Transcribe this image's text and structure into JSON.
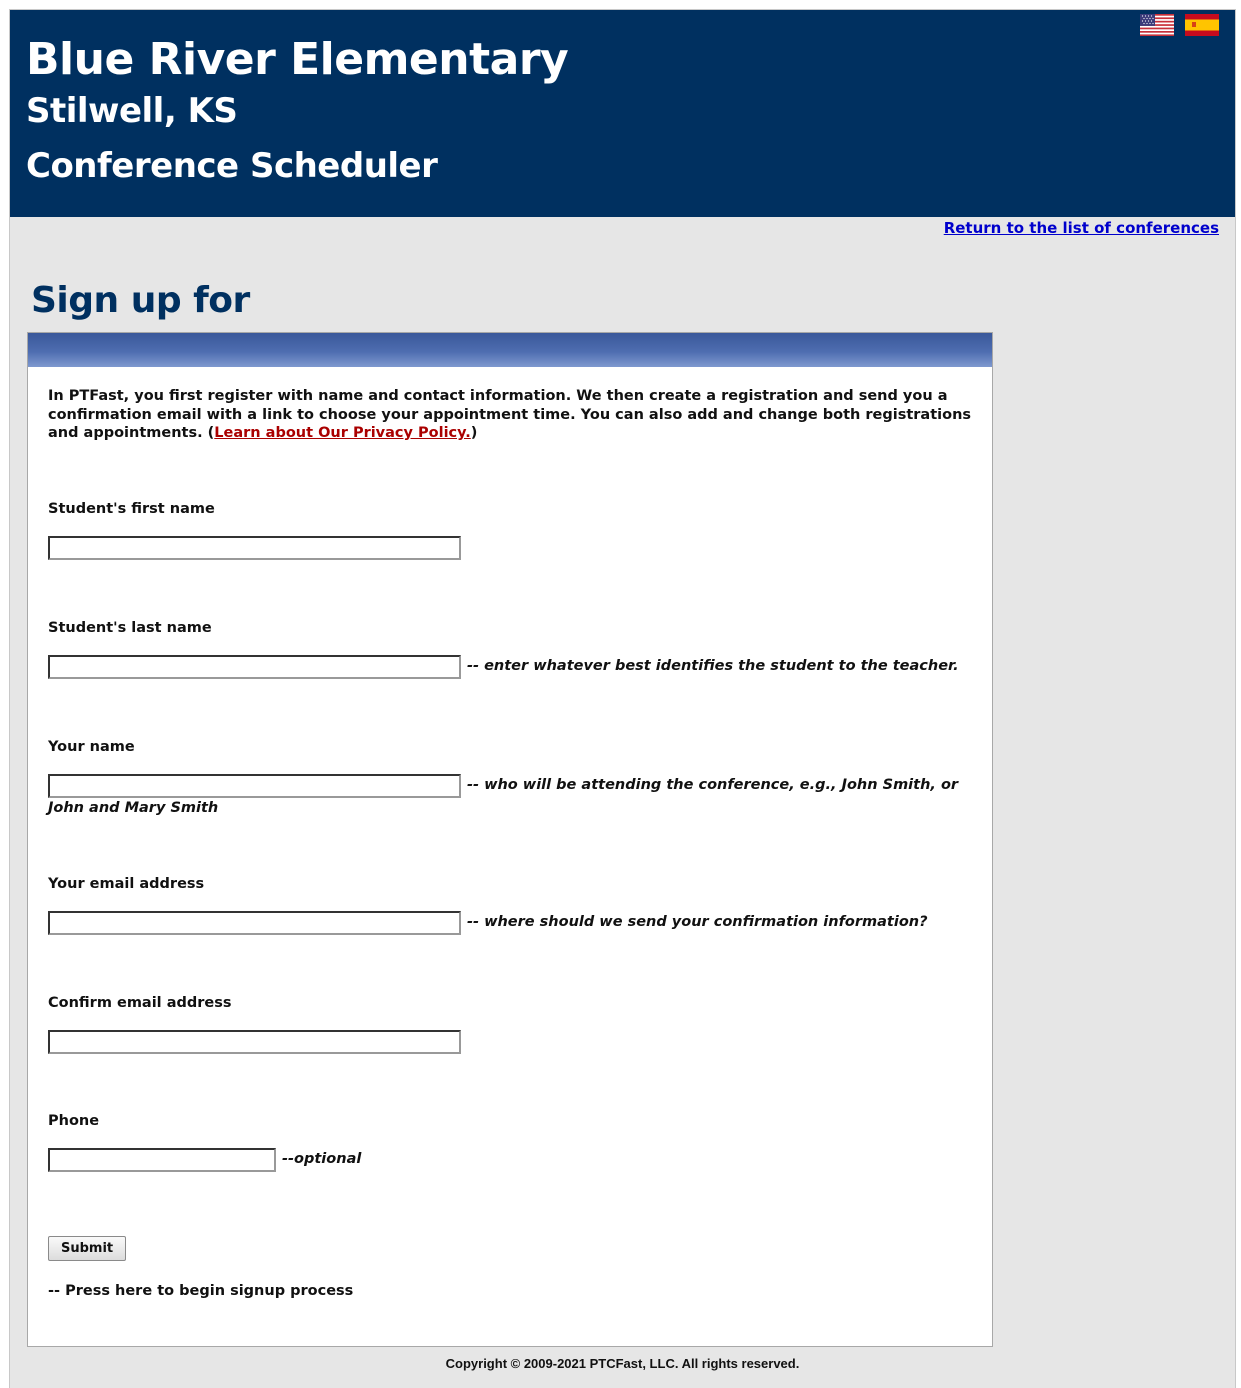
{
  "header": {
    "school_name": "Blue River Elementary",
    "city": "Stilwell, KS",
    "app_name": "Conference Scheduler",
    "languages": [
      {
        "name": "us-flag-icon",
        "label": "English"
      },
      {
        "name": "spain-flag-icon",
        "label": "Spanish"
      }
    ],
    "bg_color": "#003060"
  },
  "nav": {
    "return_link": "Return to the list of conferences"
  },
  "page": {
    "title": "Sign up for"
  },
  "intro": {
    "text_before": "In PTFast, you first register with name and contact information. We then create a registration and send you a confirmation email with a link to choose your appointment time. You can also add and change both registrations and appointments. (",
    "privacy_link": "Learn about Our Privacy Policy.",
    "text_after": ")"
  },
  "form": {
    "first_name": {
      "label": "Student's first name",
      "value": "",
      "hint": ""
    },
    "last_name": {
      "label": "Student's last name",
      "value": "",
      "hint": "-- enter whatever best identifies the student to the teacher."
    },
    "your_name": {
      "label": "Your name",
      "value": "",
      "hint": "-- who will be attending the conference, e.g., John Smith, or John and Mary Smith"
    },
    "email": {
      "label": "Your email address",
      "value": "",
      "hint": "-- where should we send your confirmation information?"
    },
    "confirm_email": {
      "label": "Confirm email address",
      "value": "",
      "hint": ""
    },
    "phone": {
      "label": "Phone",
      "value": "",
      "hint": "--optional"
    },
    "submit_label": "Submit",
    "submit_hint": "-- Press here to begin signup process"
  },
  "footer": {
    "copyright": "Copyright © 2009-2021 PTCFast, LLC. All rights reserved."
  }
}
